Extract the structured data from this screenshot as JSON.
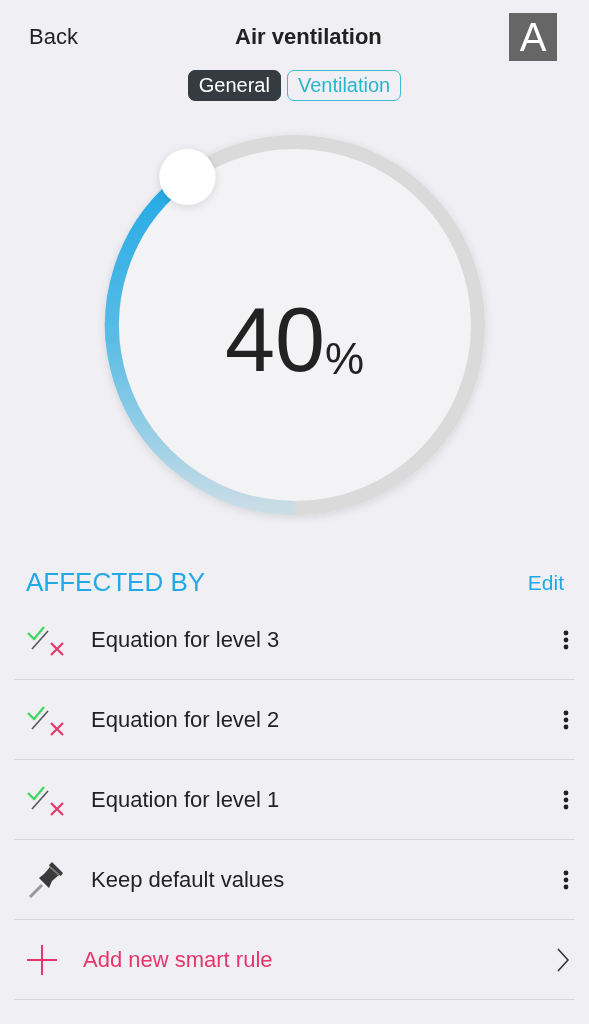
{
  "header": {
    "back": "Back",
    "title": "Air ventilation",
    "badge": "A"
  },
  "tabs": [
    {
      "label": "General",
      "selected": true
    },
    {
      "label": "Ventilation",
      "selected": false
    }
  ],
  "dial": {
    "value": "40",
    "unit": "%"
  },
  "section": {
    "title": "AFFECTED BY",
    "action": "Edit"
  },
  "rules": [
    {
      "kind": "equation",
      "label": "Equation for level 3"
    },
    {
      "kind": "equation",
      "label": "Equation for level 2"
    },
    {
      "kind": "equation",
      "label": "Equation for level 1"
    },
    {
      "kind": "pin",
      "label": "Keep default values"
    },
    {
      "kind": "add",
      "label": "Add new smart rule"
    }
  ]
}
